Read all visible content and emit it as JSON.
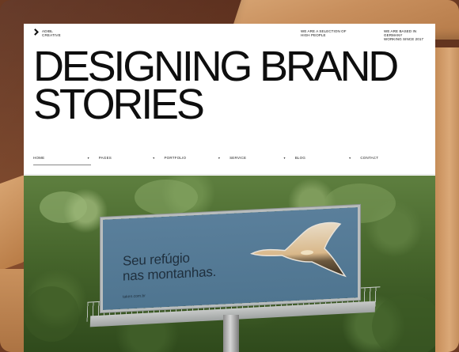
{
  "site": {
    "logo": {
      "line1": "ADIBL",
      "line2": "CREATIVE"
    },
    "taglines": [
      {
        "line1": "WE ARE A SELECTION OF",
        "line2": "HIGH PEOPLE"
      },
      {
        "line1": "WE ARE BASED IN GERMANY",
        "line2": "WORKING SINCE 2017"
      }
    ],
    "headline": {
      "line1": "DESIGNING BRAND",
      "line2": "STORIES"
    },
    "nav": [
      {
        "label": "HOME",
        "dropdown": true,
        "active": true
      },
      {
        "label": "PAGES",
        "dropdown": true
      },
      {
        "label": "PORTFOLIO",
        "dropdown": true
      },
      {
        "label": "SERVICE",
        "dropdown": true
      },
      {
        "label": "BLOG",
        "dropdown": true
      },
      {
        "label": "CONTACT",
        "dropdown": false
      }
    ],
    "chevron": "▾"
  },
  "billboard": {
    "line1": "Seu refúgio",
    "line2": "nas montanhas.",
    "url": "taken.com.br"
  },
  "colors": {
    "board": "#5a7f9b",
    "board_text": "#1f2f3d",
    "forest": "#44632a",
    "wood": "#c88f5d"
  }
}
